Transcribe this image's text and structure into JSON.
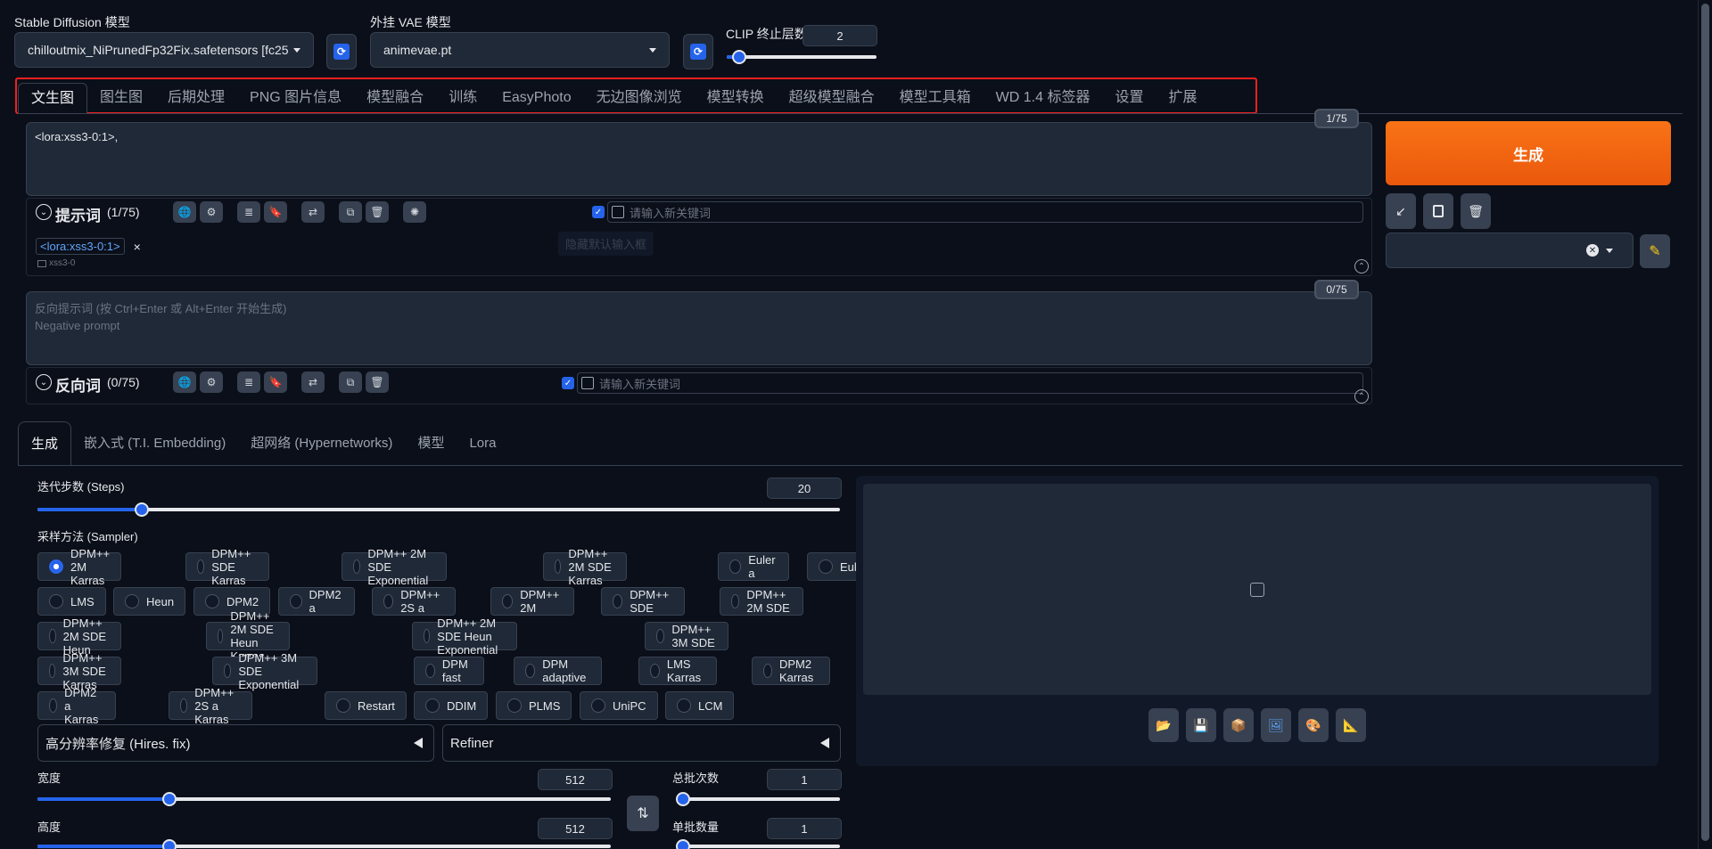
{
  "header": {
    "sd_model_label": "Stable Diffusion 模型",
    "sd_model_value": "chilloutmix_NiPrunedFp32Fix.safetensors [fc25",
    "vae_label": "外挂 VAE 模型",
    "vae_value": "animevae.pt",
    "clip_label": "CLIP 终止层数",
    "clip_value": "2",
    "clip_level": 0.0833
  },
  "tabs": [
    "文生图",
    "图生图",
    "后期处理",
    "PNG 图片信息",
    "模型融合",
    "训练",
    "EasyPhoto",
    "无边图像浏览",
    "模型转换",
    "超级模型融合",
    "模型工具箱",
    "WD 1.4 标签器",
    "设置",
    "扩展"
  ],
  "prompt": {
    "text": "<lora:xss3-0:1>,",
    "counter": "1/75",
    "title": "提示词",
    "title_count": "(1/75)",
    "keyword_placeholder": "请输入新关键词",
    "tag": "<lora:xss3-0:1>",
    "tag_close": "×",
    "tag_sub": "xss3-0",
    "hide_default": "隐藏默认输入框"
  },
  "negative": {
    "placeholder_line1": "反向提示词 (按 Ctrl+Enter 或 Alt+Enter 开始生成)",
    "placeholder_line2": "Negative prompt",
    "counter": "0/75",
    "title": "反向词",
    "title_count": "(0/75)",
    "keyword_placeholder": "请输入新关键词"
  },
  "generate": {
    "label": "生成"
  },
  "subtabs": [
    "生成",
    "嵌入式 (T.I. Embedding)",
    "超网络 (Hypernetworks)",
    "模型",
    "Lora"
  ],
  "steps": {
    "label": "迭代步数 (Steps)",
    "value": "20",
    "level": 0.13
  },
  "sampler": {
    "label": "采样方法 (Sampler)",
    "selected": "DPM++ 2M Karras",
    "options": [
      "DPM++ 2M Karras",
      "DPM++ SDE Karras",
      "DPM++ 2M SDE Exponential",
      "DPM++ 2M SDE Karras",
      "Euler a",
      "Euler",
      "LMS",
      "Heun",
      "DPM2",
      "DPM2 a",
      "DPM++ 2S a",
      "DPM++ 2M",
      "DPM++ SDE",
      "DPM++ 2M SDE",
      "DPM++ 2M SDE Heun",
      "DPM++ 2M SDE Heun Karras",
      "DPM++ 2M SDE Heun Exponential",
      "DPM++ 3M SDE",
      "DPM++ 3M SDE Karras",
      "DPM++ 3M SDE Exponential",
      "DPM fast",
      "DPM adaptive",
      "LMS Karras",
      "DPM2 Karras",
      "DPM2 a Karras",
      "DPM++ 2S a Karras",
      "Restart",
      "DDIM",
      "PLMS",
      "UniPC",
      "LCM"
    ]
  },
  "hires": {
    "label": "高分辨率修复 (Hires. fix)"
  },
  "refiner": {
    "label": "Refiner"
  },
  "width": {
    "label": "宽度",
    "value": "512",
    "level": 0.23
  },
  "height": {
    "label": "高度",
    "value": "512",
    "level": 0.23
  },
  "batch_count": {
    "label": "总批次数",
    "value": "1",
    "level": 0.0
  },
  "batch_size": {
    "label": "单批数量",
    "value": "1",
    "level": 0.0
  }
}
